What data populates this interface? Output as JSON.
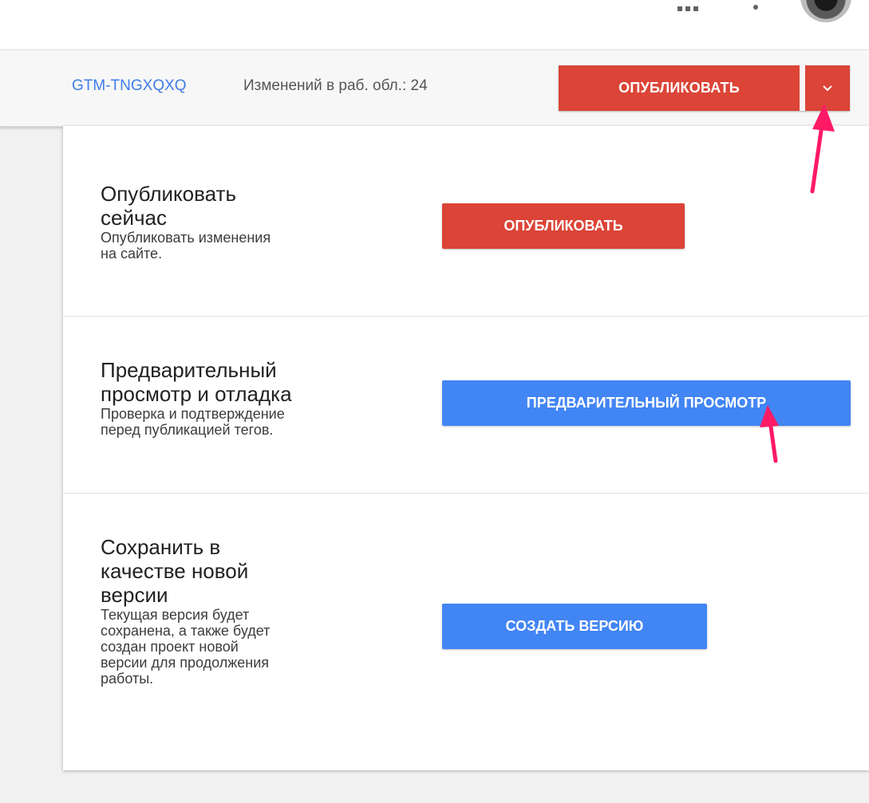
{
  "header": {
    "apps_icon": "apps-grid-icon",
    "more_icon": "more-vert-icon",
    "avatar_icon": "account-avatar-icon"
  },
  "workspace_bar": {
    "container_id": "GTM-TNGXQXQ",
    "changes_text": "Изменений в раб. обл.: 24",
    "publish_label": "ОПУБЛИКОВАТЬ",
    "dropdown_icon": "chevron-down-icon"
  },
  "sections": [
    {
      "title": "Опубликовать\nсейчас",
      "description": "Опубликовать изменения\nна сайте.",
      "button_label": "ОПУБЛИКОВАТЬ"
    },
    {
      "title": "Предварительный\nпросмотр и отладка",
      "description": "Проверка и подтверждение\nперед публикацией тегов.",
      "button_label": "ПРЕДВАРИТЕЛЬНЫЙ ПРОСМОТР"
    },
    {
      "title": "Сохранить в\nкачестве новой\nверсии",
      "description": "Текущая версия будет\nсохранена, а также будет\nсоздан проект новой\nверсии для продолжения\nработы.",
      "button_label": "СОЗДАТЬ ВЕРСИЮ"
    }
  ],
  "colors": {
    "publish_red": "#db4437",
    "preview_blue": "#4285f4",
    "link_blue": "#3f7de8",
    "annotation_pink": "#ff1a66"
  }
}
